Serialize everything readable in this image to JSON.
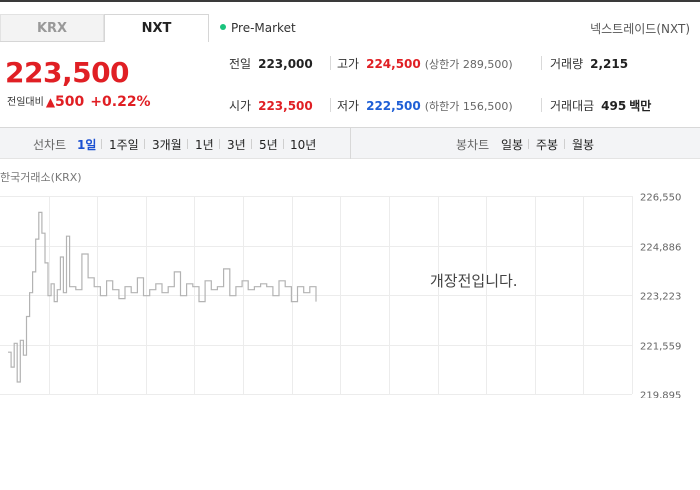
{
  "tabs": [
    {
      "label": "KRX",
      "active": false
    },
    {
      "label": "NXT",
      "active": true
    }
  ],
  "session": {
    "label": "Pre-Market",
    "color": "#19c37d"
  },
  "nxt_link": "넥스트레이드(NXT)",
  "quote": {
    "price": "223,500",
    "change_label": "전일대비",
    "change_arrow": "▲",
    "change_amount": "500",
    "change_pct": "+0.22%",
    "up_color": "#e01f24",
    "down_color": "#1f5fd6"
  },
  "stats": {
    "prev_close": {
      "label": "전일",
      "value": "223,000"
    },
    "high": {
      "label": "고가",
      "value": "224,500",
      "sub": "(상한가 289,500)"
    },
    "volume": {
      "label": "거래량",
      "value": "2,215"
    },
    "open": {
      "label": "시가",
      "value": "223,500"
    },
    "low": {
      "label": "저가",
      "value": "222,500",
      "sub": "(하한가 156,500)"
    },
    "turnover": {
      "label": "거래대금",
      "value": "495",
      "unit": "백만"
    }
  },
  "period_bar": {
    "line_label": "선차트",
    "line_periods": [
      {
        "label": "1일",
        "active": true
      },
      {
        "label": "1주일",
        "active": false
      },
      {
        "label": "3개월",
        "active": false
      },
      {
        "label": "1년",
        "active": false
      },
      {
        "label": "3년",
        "active": false
      },
      {
        "label": "5년",
        "active": false
      },
      {
        "label": "10년",
        "active": false
      }
    ],
    "candle_label": "봉차트",
    "candle_periods": [
      {
        "label": "일봉"
      },
      {
        "label": "주봉"
      },
      {
        "label": "월봉"
      }
    ]
  },
  "chart": {
    "exchange_label": "한국거래소(KRX)",
    "closed_message": "개장전입니다."
  },
  "chart_data": {
    "type": "line",
    "title": "",
    "xlabel": "",
    "ylabel": "",
    "y_ticks": [
      "226,550",
      "224,886",
      "223,223",
      "221,559",
      "219,895"
    ],
    "ylim": [
      219895,
      226550
    ],
    "grid": true,
    "line_color": "#b3b3b3",
    "series": [
      {
        "x": [
          0,
          0.01,
          0.02,
          0.03,
          0.04,
          0.05,
          0.06,
          0.07,
          0.08,
          0.09,
          0.1,
          0.11,
          0.12,
          0.13,
          0.14,
          0.15,
          0.16,
          0.17,
          0.18,
          0.19,
          0.2,
          0.22,
          0.24,
          0.26,
          0.28,
          0.3,
          0.32,
          0.34,
          0.36,
          0.38,
          0.4,
          0.42,
          0.44,
          0.46,
          0.48,
          0.5,
          0.52,
          0.54,
          0.56,
          0.58,
          0.6,
          0.62,
          0.64,
          0.66,
          0.68,
          0.7,
          0.72,
          0.74,
          0.76,
          0.78,
          0.8,
          0.82,
          0.84,
          0.86,
          0.88,
          0.9,
          0.92,
          0.94,
          0.96,
          0.98,
          1.0
        ],
        "values": [
          221300,
          220800,
          221600,
          220300,
          221700,
          221200,
          222500,
          223300,
          224000,
          225100,
          226000,
          225300,
          224300,
          223200,
          223600,
          223000,
          223400,
          224500,
          223300,
          225200,
          223500,
          223400,
          224600,
          223800,
          223500,
          223200,
          223700,
          223400,
          223100,
          223500,
          223300,
          223800,
          223200,
          223400,
          223600,
          223300,
          223500,
          224000,
          223200,
          223600,
          223500,
          223000,
          223700,
          223400,
          223500,
          224100,
          223200,
          223500,
          223700,
          223400,
          223500,
          223600,
          223500,
          223200,
          223700,
          223500,
          223000,
          223500,
          223300,
          223500,
          223000
        ]
      }
    ]
  }
}
